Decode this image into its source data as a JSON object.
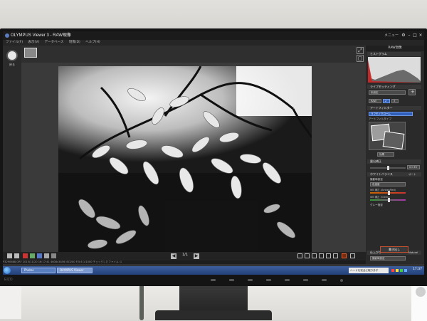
{
  "window": {
    "title": "OLYMPUS Viewer 3 - RAW現像",
    "menu_right": "メニュー"
  },
  "menubar": {
    "items": [
      "ファイル(F)",
      "表示(V)",
      "データベース",
      "現像(D)",
      "ヘルプ(H)"
    ]
  },
  "rail": {
    "label": "戻る"
  },
  "viewer": {
    "page_indicator": "1/1"
  },
  "statusline": {
    "text": "P3290688.ORF  2015/11/20  16:17:41  4608x3456  ISO200  F/5.6  1/1000  チェックしたファイル:  1"
  },
  "panel": {
    "title": "RAW現像",
    "histogram_label": "ヒストグラム",
    "setting_label": "ライブセッティング",
    "setting_value": "未設定",
    "tabs": [
      "RAW",
      "2",
      "3"
    ],
    "art_filter_label": "アートフィルター",
    "art_filter_value": "ラフモノクローム",
    "art_filter_sub": "アートフィルタイプ",
    "effect_button": "効果",
    "exposure_label": "露出補正",
    "exposure_value": "0.0 EV",
    "wb_label": "ホワイトバランス",
    "wb_mode": "オート",
    "wb_option1": "撮影時設定",
    "wb_option2": "色温度",
    "wb_option3": "グレー指定",
    "wb_amber": "WB 補正 (Amber/Red)",
    "wb_green": "WB 補正 (Green)",
    "finish_label": "仕上がり",
    "finish_mode": "Natural",
    "finish_value": "撮影時設定",
    "apply_button": "書き出し"
  },
  "taskbar": {
    "items": [
      "Photos",
      "OLYMPUS Viewer"
    ],
    "clock": "17:37",
    "ime": "ハードを安全に取り外す"
  },
  "bezel": {
    "logo": "EIZO"
  }
}
